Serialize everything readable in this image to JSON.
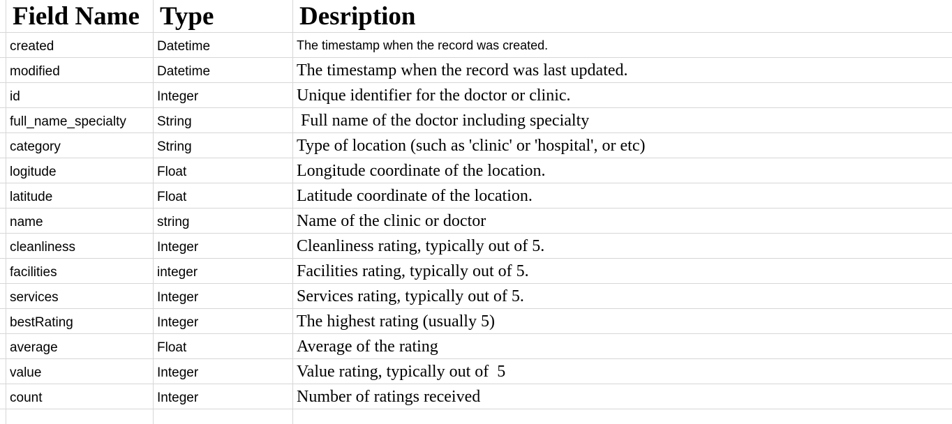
{
  "sheet": {
    "headers": [
      "Field Name",
      "Type",
      "Desription"
    ],
    "rows": [
      {
        "field": "created",
        "type": "Datetime",
        "description": "The timestamp when the record was created."
      },
      {
        "field": "modified",
        "type": "Datetime",
        "description": "The timestamp when the record was last updated."
      },
      {
        "field": "id",
        "type": "Integer",
        "description": "Unique identifier for the doctor or clinic."
      },
      {
        "field": "full_name_specialty",
        "type": "String",
        "description": " Full name of the doctor including specialty"
      },
      {
        "field": "category",
        "type": "String",
        "description": "Type of location (such as 'clinic' or 'hospital', or etc)"
      },
      {
        "field": "logitude",
        "type": "Float",
        "description": "Longitude coordinate of the location."
      },
      {
        "field": "latitude",
        "type": "Float",
        "description": "Latitude coordinate of the location."
      },
      {
        "field": "name",
        "type": "string",
        "description": "Name of the clinic or doctor"
      },
      {
        "field": "cleanliness",
        "type": "Integer",
        "description": "Cleanliness rating, typically out of 5."
      },
      {
        "field": "facilities",
        "type": "integer",
        "description": "Facilities rating, typically out of 5."
      },
      {
        "field": "services",
        "type": "Integer",
        "description": "Services rating, typically out of 5."
      },
      {
        "field": "bestRating",
        "type": "Integer",
        "description": "The highest rating (usually 5)"
      },
      {
        "field": "average",
        "type": "Float",
        "description": "Average of the rating"
      },
      {
        "field": "value",
        "type": "Integer",
        "description": "Value rating, typically out of  5"
      },
      {
        "field": "count",
        "type": "Integer",
        "description": "Number of ratings received"
      }
    ]
  },
  "colors": {
    "gridline": "#d6d6d6",
    "text": "#000000",
    "background": "#ffffff"
  }
}
